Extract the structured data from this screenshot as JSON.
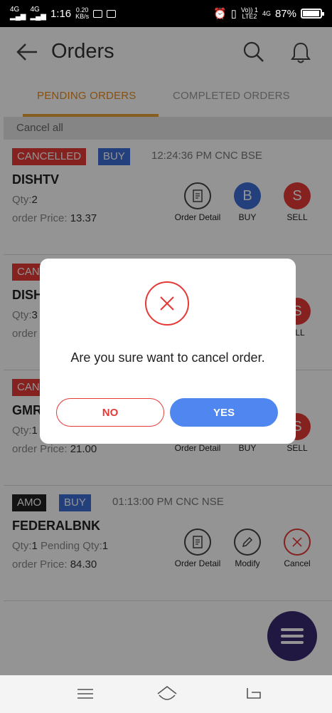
{
  "status_bar": {
    "network1": "4G",
    "network2": "4G",
    "time": "1:16",
    "speed_value": "0.20",
    "speed_unit": "KB/s",
    "volte": "Vo)) 1",
    "lte": "LTE2",
    "net_right": "4G",
    "battery": "87%"
  },
  "header": {
    "title": "Orders"
  },
  "tabs": [
    {
      "label": "PENDING ORDERS",
      "active": true
    },
    {
      "label": "COMPLETED ORDERS",
      "active": false
    }
  ],
  "cancel_all": "Cancel all",
  "orders": [
    {
      "status": "CANCELLED",
      "side": "BUY",
      "time": "12:24:36 PM",
      "product": "CNC",
      "exchange": "BSE",
      "symbol": "DISHTV",
      "qty_label": "Qty:",
      "qty_value": "2",
      "price_label": "order Price:",
      "price_value": "13.37",
      "actions": [
        "Order Detail",
        "BUY",
        "SELL"
      ]
    },
    {
      "status": "CAN",
      "symbol": "DISH",
      "qty_label": "Qty:",
      "qty_value": "3",
      "price_label": "order",
      "actions": [
        "ELL"
      ]
    },
    {
      "status": "CAN",
      "symbol": "GMR",
      "qty_label": "Qty:",
      "qty_value": "1",
      "price_label": "order Price:",
      "price_value": "21.00",
      "actions": [
        "Order Detail",
        "BUY",
        "SELL"
      ]
    },
    {
      "status": "AMO",
      "side": "BUY",
      "time": "01:13:00 PM",
      "product": "CNC",
      "exchange": "NSE",
      "symbol": "FEDERALBNK",
      "qty_label": "Qty:",
      "qty_value": "1",
      "pending_label": "Pending Qty:",
      "pending_value": "1",
      "price_label": "order Price:",
      "price_value": "84.30",
      "actions": [
        "Order Detail",
        "Modify",
        "Cancel"
      ]
    }
  ],
  "buy_icon_letter": "B",
  "sell_icon_letter": "S",
  "dialog": {
    "message": "Are you sure want to cancel order.",
    "no_label": "NO",
    "yes_label": "YES"
  },
  "colors": {
    "accent_orange": "#e88a1a",
    "cancelled_red": "#e53935",
    "buy_blue": "#3d6fd6",
    "yes_blue": "#4f86f0",
    "fab_purple": "#3a2a70"
  }
}
